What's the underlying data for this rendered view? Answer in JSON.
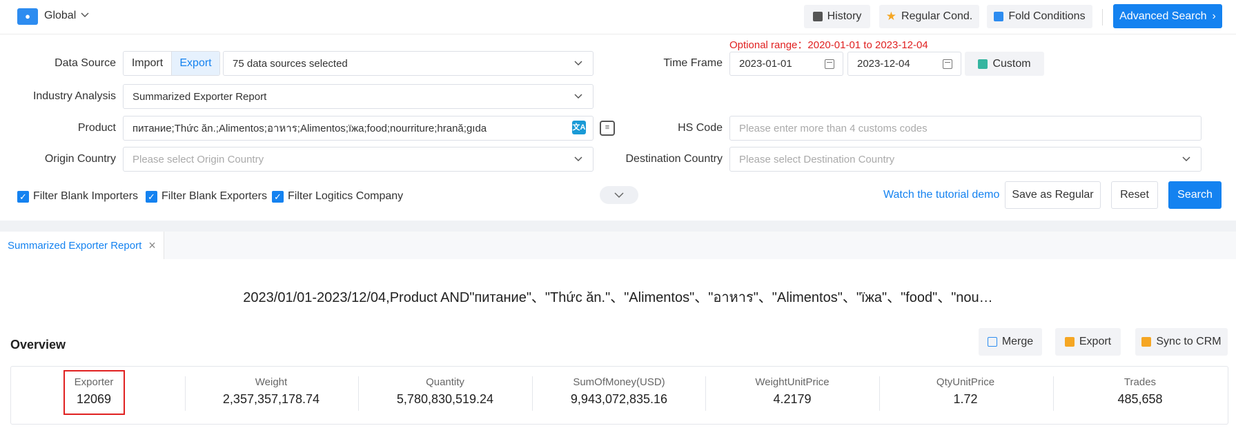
{
  "topbar": {
    "scope_label": "Global",
    "buttons": {
      "history": "History",
      "regular": "Regular Cond.",
      "fold": "Fold Conditions",
      "advanced": "Advanced Search"
    }
  },
  "optional_range": "Optional range：2020-01-01 to 2023-12-04",
  "form": {
    "data_source": {
      "label": "Data Source",
      "import_label": "Import",
      "export_label": "Export",
      "selected": "75 data sources selected"
    },
    "time_frame": {
      "label": "Time Frame",
      "start": "2023-01-01",
      "end": "2023-12-04",
      "custom_label": "Custom"
    },
    "industry_analysis": {
      "label": "Industry Analysis",
      "value": "Summarized Exporter Report"
    },
    "product": {
      "label": "Product",
      "value": "питание;Thức ăn.;Alimentos;อาหาร;Alimentos;їжа;food;nourriture;hrană;gıda"
    },
    "hs_code": {
      "label": "HS Code",
      "placeholder": "Please enter more than 4 customs codes"
    },
    "origin_country": {
      "label": "Origin Country",
      "placeholder": "Please select Origin Country"
    },
    "destination_country": {
      "label": "Destination Country",
      "placeholder": "Please select Destination Country"
    }
  },
  "filters": {
    "blank_importers": "Filter Blank Importers",
    "blank_exporters": "Filter Blank Exporters",
    "logistics": "Filter Logitics Company"
  },
  "actions": {
    "tutorial": "Watch the tutorial demo",
    "save_regular": "Save as Regular",
    "reset": "Reset",
    "search": "Search"
  },
  "tab": {
    "label": "Summarized Exporter Report"
  },
  "query_summary": "2023/01/01-2023/12/04,Product AND\"питание\"、\"Thức ăn.\"、\"Alimentos\"、\"อาหาร\"、\"Alimentos\"、\"їжа\"、\"food\"、\"nou…",
  "overview": {
    "title": "Overview",
    "merge": "Merge",
    "export": "Export",
    "sync": "Sync to CRM",
    "stats": [
      {
        "label": "Exporter",
        "value": "12069"
      },
      {
        "label": "Weight",
        "value": "2,357,357,178.74"
      },
      {
        "label": "Quantity",
        "value": "5,780,830,519.24"
      },
      {
        "label": "SumOfMoney(USD)",
        "value": "9,943,072,835.16"
      },
      {
        "label": "WeightUnitPrice",
        "value": "4.2179"
      },
      {
        "label": "QtyUnitPrice",
        "value": "1.72"
      },
      {
        "label": "Trades",
        "value": "485,658"
      }
    ]
  },
  "colors": {
    "primary": "#1482f0",
    "highlight": "#e02020"
  }
}
